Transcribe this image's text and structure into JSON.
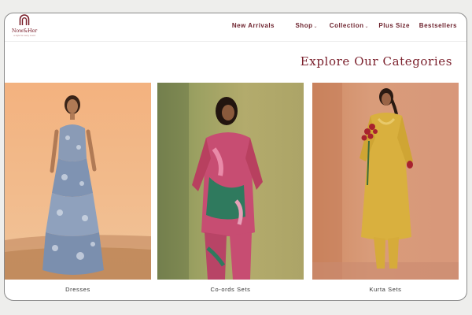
{
  "brand": {
    "name": "Now&Her",
    "tagline": "a style for every mood"
  },
  "nav": {
    "items": [
      {
        "label": "New Arrivals",
        "has_dropdown": false
      },
      {
        "label": "Shop",
        "has_dropdown": true
      },
      {
        "label": "Collection",
        "has_dropdown": true
      },
      {
        "label": "Plus Size",
        "has_dropdown": false
      },
      {
        "label": "Bestsellers",
        "has_dropdown": false
      }
    ],
    "dropdown_glyph": "⌄"
  },
  "section": {
    "title": "Explore Our Categories"
  },
  "categories": [
    {
      "label": "Dresses"
    },
    {
      "label": "Co-ords Sets"
    },
    {
      "label": "Kurta Sets"
    }
  ],
  "colors": {
    "brand": "#7a1f2b",
    "nav_text": "#6b1f2a"
  }
}
